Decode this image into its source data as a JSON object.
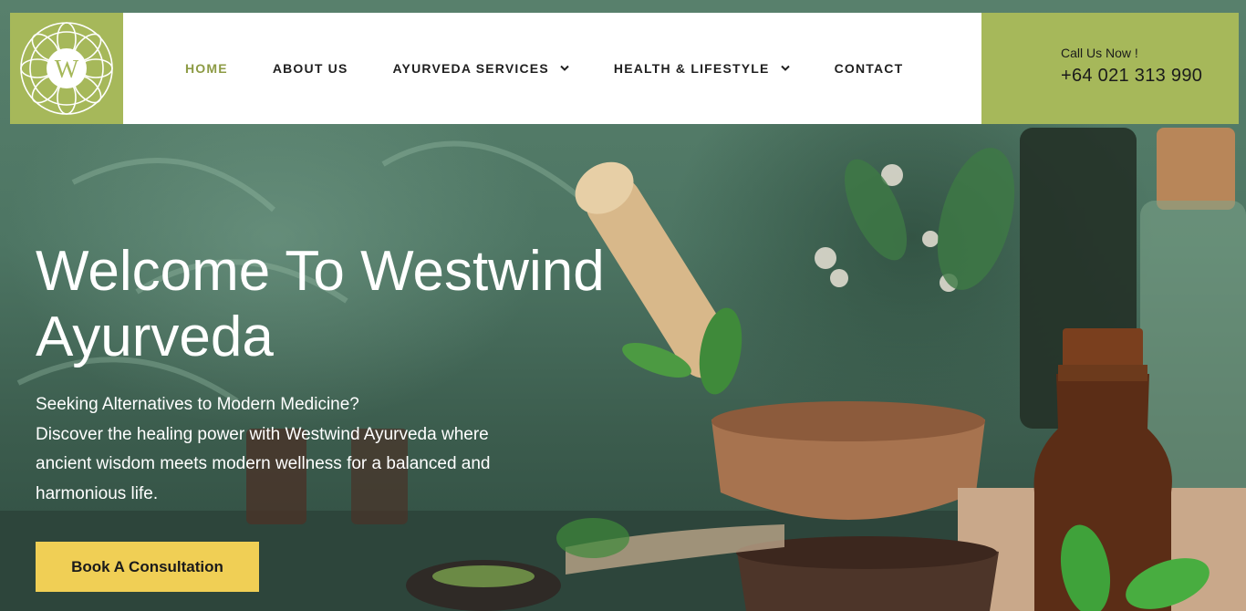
{
  "header": {
    "logo_letter": "W",
    "nav": [
      {
        "label": "HOME",
        "active": true,
        "has_dropdown": false
      },
      {
        "label": "ABOUT US",
        "active": false,
        "has_dropdown": false
      },
      {
        "label": "AYURVEDA SERVICES",
        "active": false,
        "has_dropdown": true
      },
      {
        "label": "HEALTH & LIFESTYLE",
        "active": false,
        "has_dropdown": true
      },
      {
        "label": "CONTACT",
        "active": false,
        "has_dropdown": false
      }
    ],
    "call_label": "Call Us Now !",
    "phone": "+64 021 313 990"
  },
  "hero": {
    "title_line1": "Welcome To Westwind",
    "title_line2": "Ayurveda",
    "subtitle_lines": [
      "Seeking Alternatives to Modern Medicine?",
      "Discover the healing power with Westwind Ayurveda where",
      "ancient wisdom meets modern wellness for a balanced and",
      "harmonious life."
    ],
    "cta_label": "Book A Consultation"
  },
  "colors": {
    "accent_green": "#a6b85a",
    "active_nav": "#8d9b45",
    "cta_yellow": "#f0cf55",
    "hero_bg": "#4d7563"
  },
  "icons": {
    "logo": "mandala-logo-icon",
    "dropdown": "chevron-down-icon"
  }
}
